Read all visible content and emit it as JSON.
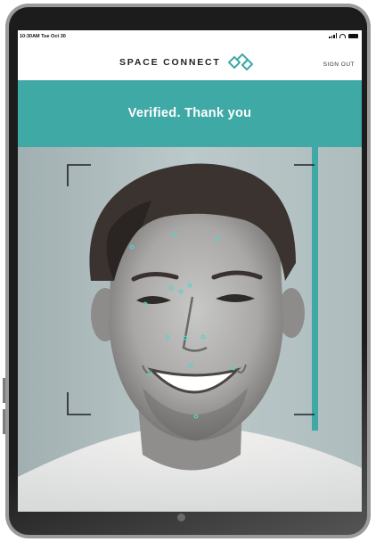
{
  "status_bar": {
    "time": "10:30AM Tue Oct 30"
  },
  "header": {
    "brand": "SPACE CONNECT",
    "sign_out": "SIGN OUT"
  },
  "banner": {
    "message": "Verified. Thank you"
  },
  "colors": {
    "accent": "#3fa9a6",
    "bezel": "#1c1c1c",
    "frame": "#9a9a9a"
  },
  "icons": {
    "logo": "space-connect-logo-icon"
  }
}
